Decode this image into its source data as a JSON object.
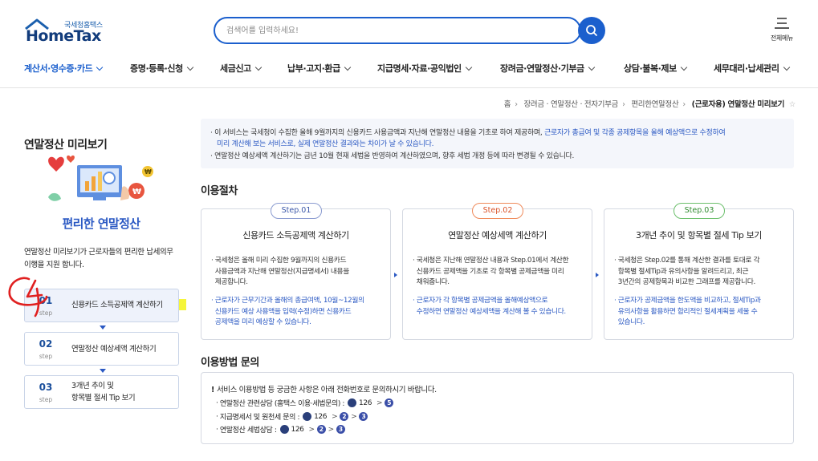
{
  "header": {
    "logo_sub": "국세청홈택스",
    "logo_main": "HomeTax",
    "search_placeholder": "검색어를 입력하세요!",
    "menu_label": "전체메뉴"
  },
  "nav": [
    {
      "label": "계산서·영수증·카드",
      "active": true
    },
    {
      "label": "증명·등록·신청"
    },
    {
      "label": "세금신고"
    },
    {
      "label": "납부·고지·환급"
    },
    {
      "label": "지급명세·자료·공익법인"
    },
    {
      "label": "장려금·연말정산·기부금"
    },
    {
      "label": "상담·불복·제보"
    },
    {
      "label": "세무대리·납세관리"
    }
  ],
  "breadcrumb": {
    "items": [
      "홈",
      "장려금 · 연말정산 · 전자기부금",
      "편리한연말정산"
    ],
    "current": "(근로자용) 연말정산 미리보기"
  },
  "sidebar": {
    "title": "연말정산 미리보기",
    "illust_caption": "편리한 연말정산",
    "description": "연말정산 미리보기가 근로자들의 편리한 납세의무 이행을 지원 합니다.",
    "steps": [
      {
        "num": "01",
        "sub": "step",
        "label": "신용카드 소득공제액 계산하기"
      },
      {
        "num": "02",
        "sub": "step",
        "label": "연말정산 예상세액 계산하기"
      },
      {
        "num": "03",
        "sub": "step",
        "label_line1": "3개년 추이 및",
        "label_line2": "항목별 절세 Tip 보기"
      }
    ]
  },
  "notice": {
    "l1a": "이 서비스는 국세청이 수집한 올해 9월까지의 신용카드 사용금액과 지난해 연말정산 내용을 기초로 하여 제공하며,",
    "l1b": "근로자가 총급여 및 각종 공제항목을 올해 예상액으로 수정하여",
    "l2": "미리 계산해 보는 서비스로, 실제 연말정산 결과와는 차이가 날 수 있습니다.",
    "l3": "연말정산 예상세액 계산하기는 금년 10월 현재 세법을 반영하여 계산하였으며, 향후 세법 개정 등에 따라 변경될 수 있습니다."
  },
  "procedure": {
    "title": "이용절차",
    "steps": [
      {
        "pill": "Step.01",
        "title": "신용카드 소득공제액 계산하기",
        "text1": [
          "국세청은 올해 미리 수집한 9월까지의 신용카드",
          "사용금액과 지난해 연말정산(지급명세서) 내용을",
          "제공합니다."
        ],
        "text2": [
          "근로자가 근무기간과 올해의 총급여액, 10월~12월의",
          "신용카드 예상 사용액을 입력(수정)하면 신용카드",
          "공제액을 미리 예상할 수 있습니다."
        ]
      },
      {
        "pill": "Step.02",
        "title": "연말정산 예상세액 계산하기",
        "text1": [
          "국세청은 지난해 연말정산 내용과 Step.01에서 계산한",
          "신용카드 공제액을 기초로 각 항목별 공제금액을 미리",
          "채워줍니다."
        ],
        "text2": [
          "근로자가 각 항목별 공제금액을 올해예상액으로",
          "수정하면 연말정산 예상세액을 계산해 볼 수 있습니다."
        ]
      },
      {
        "pill": "Step.03",
        "title": "3개년 추이 및 항목별 절세 Tip 보기",
        "text1": [
          "국세청은 Step.02를 통해 계산한 결과를 토대로 각",
          "항목별 절세Tip과 유의사항을 알려드리고, 최근",
          "3년간의 공제항목과 비교한 그래프를 제공합니다."
        ],
        "text2": [
          "근로자가 공제금액을 한도액을 비교하고, 절세Tip과",
          "유의사항을 활용하면 합리적인 절세계획을 세울 수",
          "있습니다."
        ]
      }
    ]
  },
  "inquiry": {
    "title": "이용방법 문의",
    "head": "서비스 이용방법 등 궁금한 사항은 아래 전화번호로 문의하시기 바랍니다.",
    "rows": [
      {
        "label": "연말정산 관련상담 (홈택스 이용·세법문의) :",
        "num": "126",
        "codes": [
          "5"
        ]
      },
      {
        "label": "지급명세서 및 원천세 문의 :",
        "num": "126",
        "codes": [
          "2",
          "3"
        ]
      },
      {
        "label": "연말정산 세법상담 :",
        "num": "126",
        "codes": [
          "2",
          "3"
        ]
      }
    ]
  }
}
